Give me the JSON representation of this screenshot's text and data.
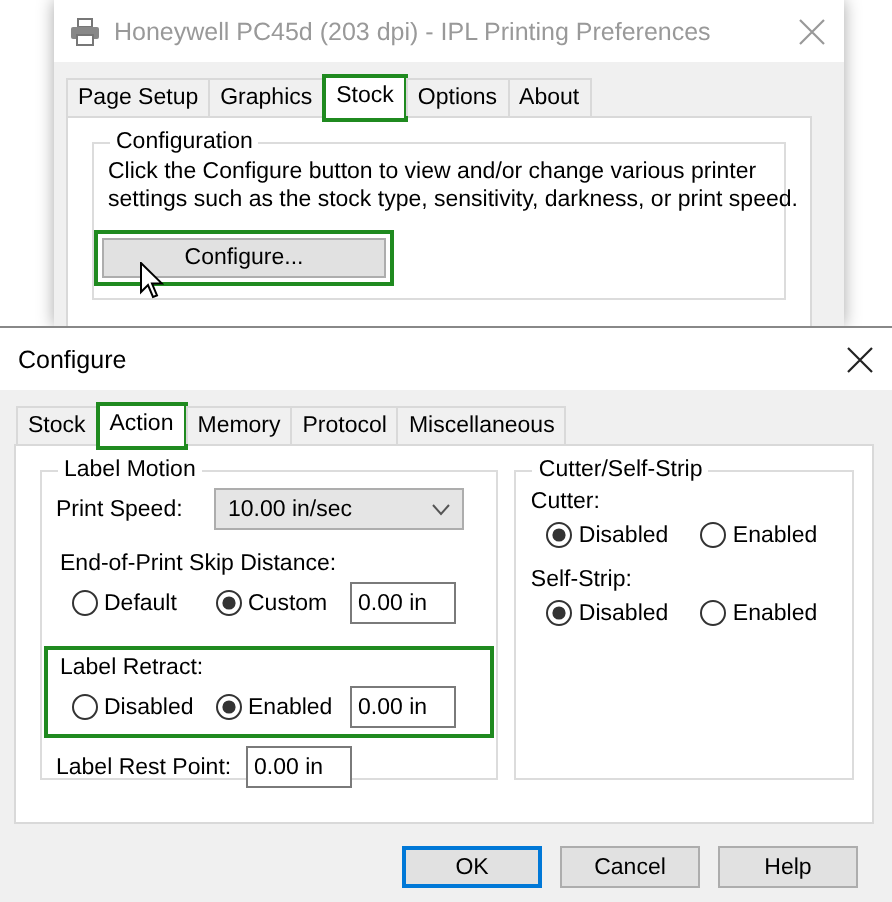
{
  "back_window": {
    "title": "Honeywell PC45d (203 dpi) - IPL Printing Preferences",
    "tabs": [
      {
        "label": "Page Setup",
        "selected": false,
        "highlighted": false
      },
      {
        "label": "Graphics",
        "selected": false,
        "highlighted": false
      },
      {
        "label": "Stock",
        "selected": true,
        "highlighted": true
      },
      {
        "label": "Options",
        "selected": false,
        "highlighted": false
      },
      {
        "label": "About",
        "selected": false,
        "highlighted": false
      }
    ],
    "group": {
      "title": "Configuration",
      "description": "Click the Configure button to view and/or change various printer settings such as the stock type, sensitivity, darkness, or print speed.",
      "button": {
        "label": "Configure...",
        "highlighted": true
      }
    }
  },
  "dialog": {
    "title": "Configure",
    "tabs": [
      {
        "label": "Stock",
        "selected": false,
        "highlighted": false
      },
      {
        "label": "Action",
        "selected": true,
        "highlighted": true
      },
      {
        "label": "Memory",
        "selected": false,
        "highlighted": false
      },
      {
        "label": "Protocol",
        "selected": false,
        "highlighted": false
      },
      {
        "label": "Miscellaneous",
        "selected": false,
        "highlighted": false
      }
    ],
    "label_motion": {
      "title": "Label Motion",
      "print_speed": {
        "label": "Print Speed:",
        "value": "10.00 in/sec"
      },
      "skip_distance": {
        "label": "End-of-Print Skip Distance:",
        "highlighted": false,
        "value": "0.00 in",
        "options": [
          {
            "label": "Default",
            "selected": false
          },
          {
            "label": "Custom",
            "selected": true
          }
        ]
      },
      "label_retract": {
        "label": "Label Retract:",
        "highlighted": true,
        "value": "0.00 in",
        "options": [
          {
            "label": "Disabled",
            "selected": false
          },
          {
            "label": "Enabled",
            "selected": true
          }
        ]
      },
      "rest_point": {
        "label": "Label Rest Point:",
        "value": "0.00 in"
      }
    },
    "cutter_group": {
      "title": "Cutter/Self-Strip",
      "settings": [
        {
          "label": "Cutter:",
          "options": [
            {
              "label": "Disabled",
              "selected": true
            },
            {
              "label": "Enabled",
              "selected": false
            }
          ]
        },
        {
          "label": "Self-Strip:",
          "options": [
            {
              "label": "Disabled",
              "selected": true
            },
            {
              "label": "Enabled",
              "selected": false
            }
          ]
        }
      ]
    },
    "buttons": [
      {
        "label": "OK",
        "default": true
      },
      {
        "label": "Cancel",
        "default": false
      },
      {
        "label": "Help",
        "default": false
      }
    ]
  }
}
